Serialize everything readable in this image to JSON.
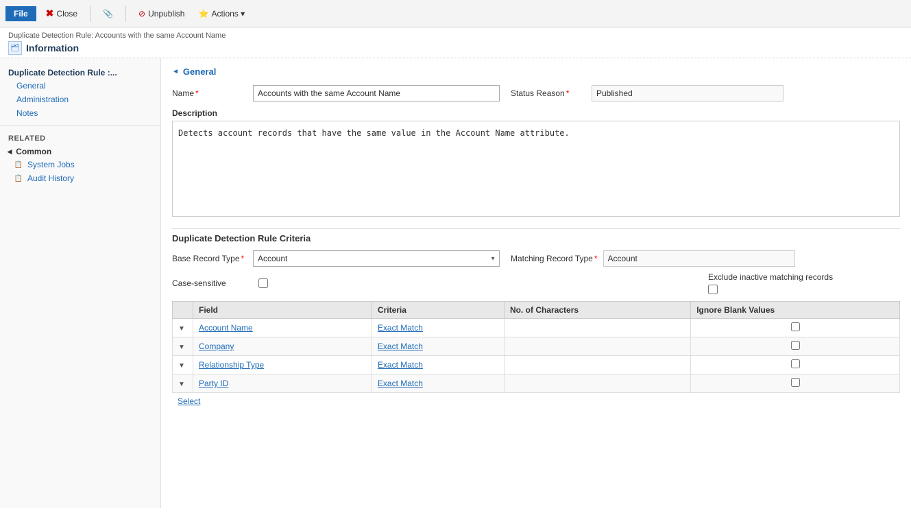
{
  "toolbar": {
    "file_label": "File",
    "close_label": "Close",
    "unpublish_label": "Unpublish",
    "actions_label": "Actions ▾"
  },
  "breadcrumb": "Duplicate Detection Rule: Accounts with the same Account Name",
  "page_title": "Information",
  "sidebar": {
    "section_title": "Duplicate Detection Rule :...",
    "nav_items": [
      {
        "label": "General",
        "id": "general"
      },
      {
        "label": "Administration",
        "id": "administration"
      },
      {
        "label": "Notes",
        "id": "notes"
      }
    ],
    "related_title": "Related",
    "common_title": "◄ Common",
    "common_items": [
      {
        "label": "System Jobs",
        "icon": "📋"
      },
      {
        "label": "Audit History",
        "icon": "📋"
      }
    ]
  },
  "general_section": {
    "title": "General",
    "name_label": "Name",
    "name_value": "Accounts with the same Account Name",
    "status_reason_label": "Status Reason",
    "status_reason_value": "Published",
    "description_label": "Description",
    "description_value": "Detects account records that have the same value in the Account Name attribute."
  },
  "criteria_section": {
    "title": "Duplicate Detection Rule Criteria",
    "base_record_label": "Base Record Type",
    "base_record_value": "Account",
    "matching_record_label": "Matching Record Type",
    "matching_record_value": "Account",
    "case_sensitive_label": "Case-sensitive",
    "exclude_inactive_label": "Exclude inactive matching records",
    "table_headers": [
      "",
      "Field",
      "Criteria",
      "No. of Characters",
      "Ignore Blank Values"
    ],
    "table_rows": [
      {
        "field": "Account Name",
        "criteria": "Exact Match",
        "chars": "",
        "ignore_blank": false
      },
      {
        "field": "Company",
        "criteria": "Exact Match",
        "chars": "",
        "ignore_blank": false
      },
      {
        "field": "Relationship Type",
        "criteria": "Exact Match",
        "chars": "",
        "ignore_blank": false
      },
      {
        "field": "Party ID",
        "criteria": "Exact Match",
        "chars": "",
        "ignore_blank": false
      }
    ],
    "select_label": "Select"
  }
}
